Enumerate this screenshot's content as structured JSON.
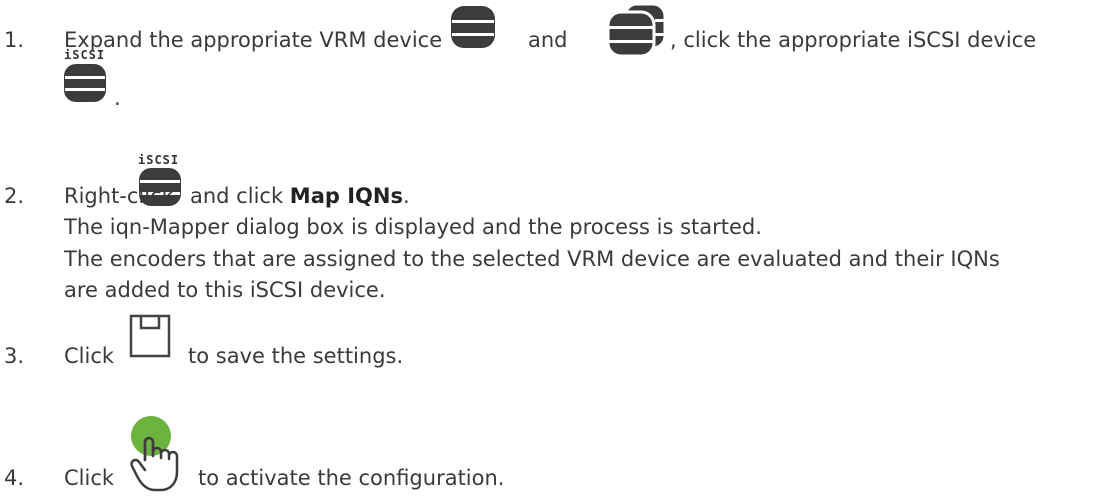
{
  "steps": [
    {
      "number": "1.",
      "text_a": "Expand the appropriate VRM device",
      "text_b": "and",
      "text_c": ", click the appropriate iSCSI device",
      "text_d": "."
    },
    {
      "number": "2.",
      "text_a": "Right-click",
      "text_b": "and click",
      "bold": "Map IQNs",
      "text_c": ".",
      "line2": "The iqn-Mapper dialog box is displayed and the process is started.",
      "line3": "The encoders that are assigned to the selected VRM device are evaluated and their IQNs",
      "line4": "are added to this iSCSI device."
    },
    {
      "number": "3.",
      "text_a": "Click",
      "text_b": "to save the settings."
    },
    {
      "number": "4.",
      "text_a": "Click",
      "text_b": "to activate the configuration."
    }
  ],
  "icons": {
    "iscsi_label": "iSCSI",
    "vrm_icon": "database-icon",
    "vrm_multi_icon": "database-stack-icon",
    "iscsi_icon": "iscsi-database-icon",
    "save_icon": "save-icon",
    "activate_icon": "activate-hand-icon"
  },
  "colors": {
    "text": "#3a3a3a",
    "icon_dark": "#3c3c3c",
    "activate_green": "#6cb33f"
  }
}
